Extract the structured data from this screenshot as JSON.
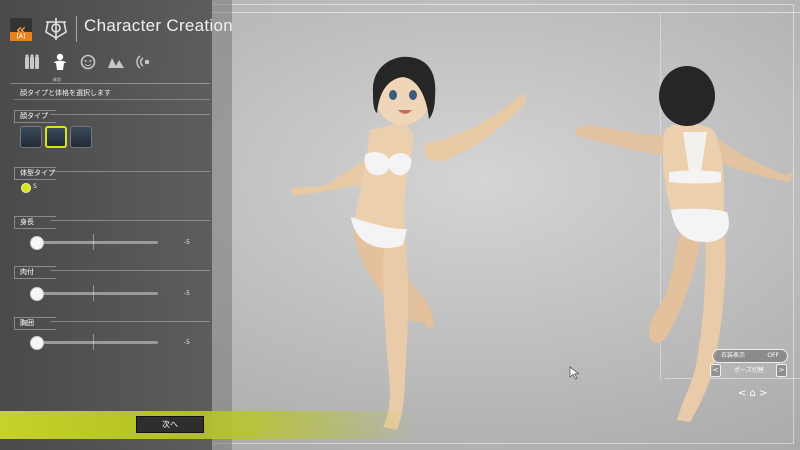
{
  "header": {
    "back_key": "[A]",
    "title": "Character Creation"
  },
  "categories": {
    "items": [
      "parts-icon",
      "body-icon",
      "face-icon",
      "hair-icon",
      "voice-icon"
    ],
    "active_label": "体型"
  },
  "instruction": "顔タイプと体格を選択します",
  "face_type": {
    "label": "顔タイプ",
    "options_count": 3,
    "selected_index": 1
  },
  "body_type": {
    "label": "体型タイプ",
    "selected": "S"
  },
  "sliders": [
    {
      "label": "身長",
      "value": "-5",
      "level": 0.0
    },
    {
      "label": "肉付",
      "value": "-5",
      "level": 0.0
    },
    {
      "label": "胸囲",
      "value": "-5",
      "level": 0.0
    }
  ],
  "footer": {
    "next_label": "次へ"
  },
  "controls": {
    "costume_label": "衣装表示",
    "costume_value": "OFF",
    "pose_label": "ポーズ切替",
    "prev_arrow": "<",
    "next_arrow": ">",
    "rotate": "< ⌂ >"
  },
  "colors": {
    "accent": "#d4e51a",
    "panel": "#585858",
    "back_icon": "#f6a13a",
    "key_badge": "#e8821f"
  }
}
